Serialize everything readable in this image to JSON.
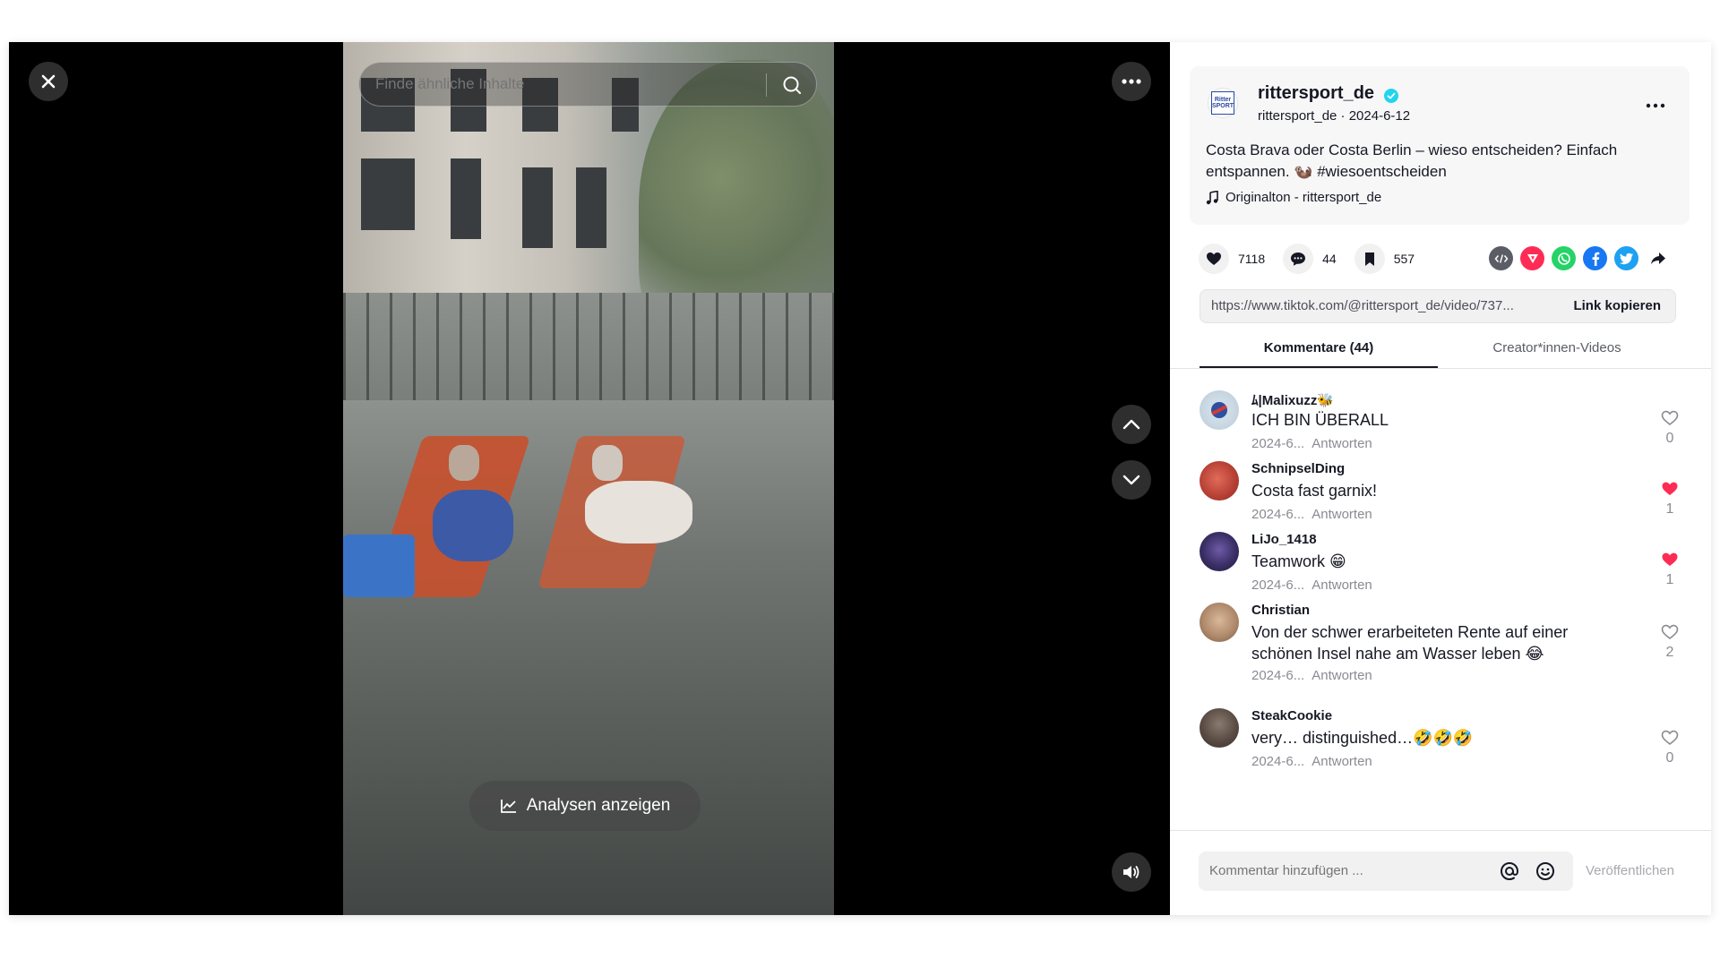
{
  "player": {
    "search_placeholder": "Finde ähnliche Inhalte",
    "analytics_label": "Analysen anzeigen"
  },
  "post": {
    "username": "rittersport_de",
    "handle_date": "rittersport_de · 2024-6-12",
    "logo_text": "Ritter SPORT",
    "description": "Costa Brava oder Costa Berlin – wieso entscheiden? Einfach entspannen. 🦦 #wiesoentscheiden",
    "music": "Originalton - rittersport_de",
    "likes": "7118",
    "comments": "44",
    "saves": "557",
    "link_url": "https://www.tiktok.com/@rittersport_de/video/737...",
    "copy_label": "Link kopieren"
  },
  "tabs": {
    "comments_label": "Kommentare (44)",
    "creator_label": "Creator*innen-Videos"
  },
  "comments": [
    {
      "user": "ﾑ|Malixuzz🐝",
      "text": "ICH BIN ÜBERALL",
      "date": "2024-6...",
      "reply": "Antworten",
      "likes": "0",
      "liked": false
    },
    {
      "user": "SchnipselDing",
      "text": "Costa fast garnix!",
      "date": "2024-6...",
      "reply": "Antworten",
      "likes": "1",
      "liked": true
    },
    {
      "user": "LiJo_1418",
      "text": "Teamwork 😁",
      "date": "2024-6...",
      "reply": "Antworten",
      "likes": "1",
      "liked": true
    },
    {
      "user": "Christian",
      "text": "Von der schwer erarbeiteten Rente auf einer schönen Insel nahe am Wasser leben 😂",
      "date": "2024-6...",
      "reply": "Antworten",
      "likes": "2",
      "liked": false
    },
    {
      "user": "SteakCookie",
      "text": "very… distinguished…🤣🤣🤣",
      "date": "2024-6...",
      "reply": "Antworten",
      "likes": "0",
      "liked": false
    }
  ],
  "compose": {
    "placeholder": "Kommentar hinzufügen ...",
    "publish_label": "Veröffentlichen"
  },
  "colors": {
    "liked": "#fe2c55",
    "whatsapp": "#25d366",
    "facebook": "#1877f2",
    "twitter": "#1da1f2",
    "red_share": "#fe2c55",
    "embed": "#5b5d66"
  }
}
